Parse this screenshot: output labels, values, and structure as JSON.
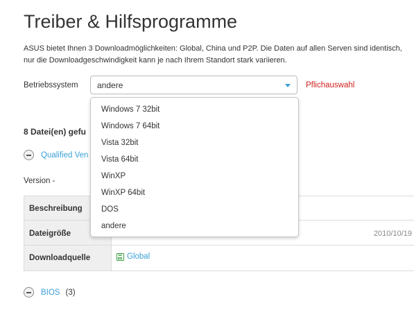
{
  "page": {
    "title": "Treiber & Hilfsprogramme",
    "description_line1": "ASUS bietet Ihnen 3 Downloadmöglichkeiten: Global, China und P2P. Die Daten auf allen Serven sind identisch,",
    "description_line2": "nur die Downloadgeschwindigkeit kann je nach Ihrem Standort stark variieren."
  },
  "os_select": {
    "label": "Betriebssystem",
    "selected": "andere",
    "required_label": "Pflichauswahl",
    "options": [
      "Windows 7 32bit",
      "Windows 7 64bit",
      "Vista 32bit",
      "Vista 64bit",
      "WinXP",
      "WinXP 64bit",
      "DOS",
      "andere"
    ]
  },
  "results": {
    "count_text": "8 Datei(en) gefu",
    "section1_label": "Qualified Ven",
    "version_text": "Version -",
    "table": {
      "row1_label": "Beschreibung",
      "row2_label": "Dateigröße",
      "row2_date": "2010/10/19",
      "row3_label": "Downloadquelle",
      "download_link": "Global"
    },
    "section2_label": "BIOS",
    "section2_count": "(3)"
  },
  "colors": {
    "accent": "#3aa0d8",
    "required": "#d02020",
    "download_icon": "#3aa040"
  }
}
